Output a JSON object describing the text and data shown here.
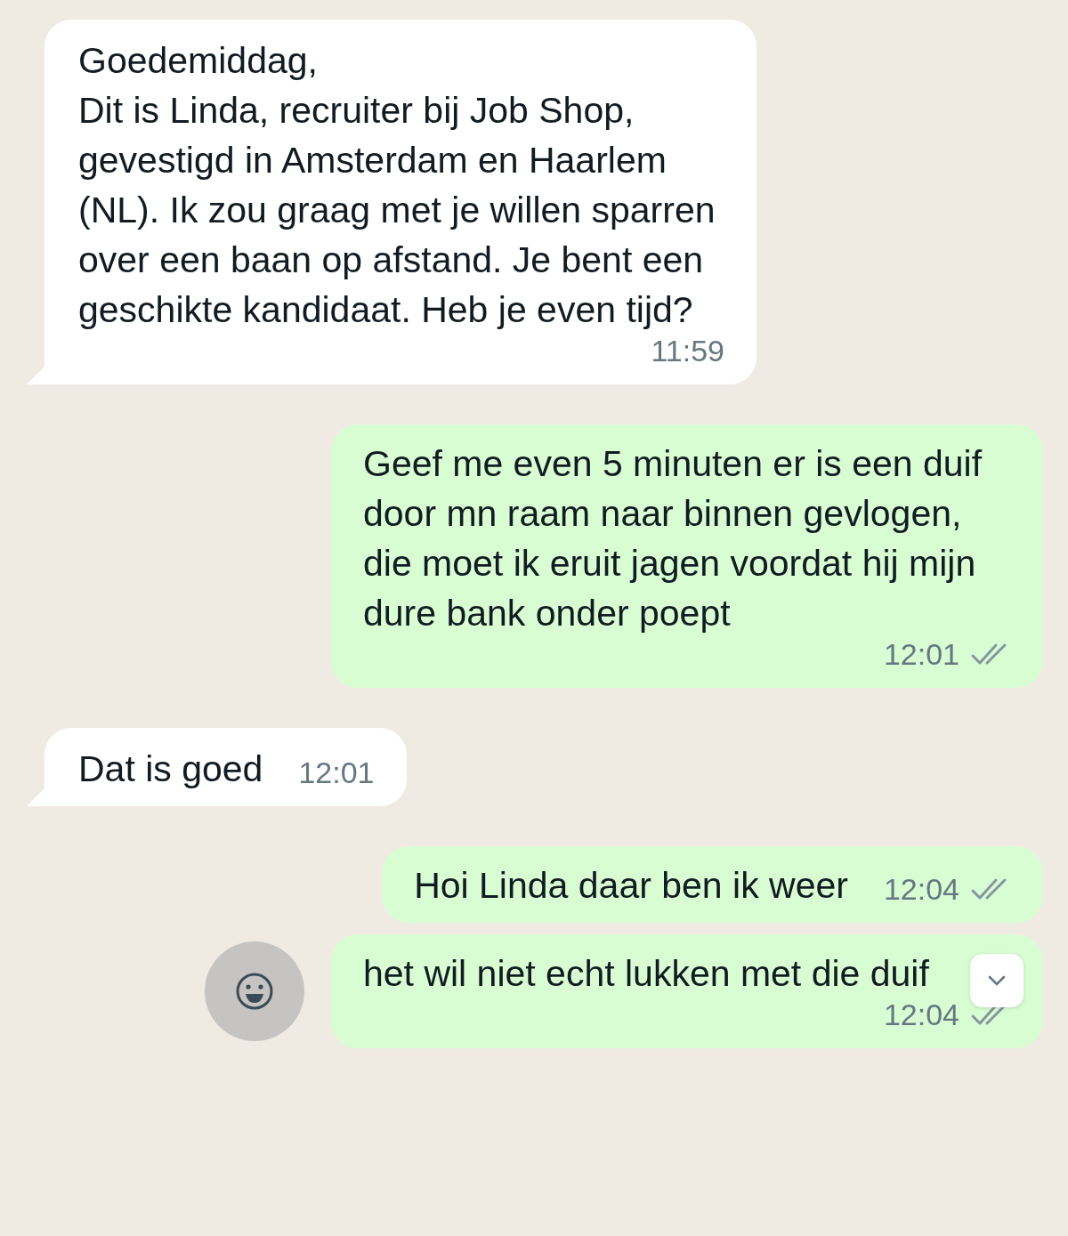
{
  "messages": [
    {
      "outgoing": false,
      "text": "Goedemiddag,\nDit is Linda, recruiter bij Job Shop, gevestigd in Amsterdam en Haarlem (NL). Ik zou graag met je willen sparren over een baan op afstand. Je bent een geschikte kandidaat. Heb je even tijd?",
      "time": "11:59"
    },
    {
      "outgoing": true,
      "text": "Geef me even 5 minuten er is een duif door mn raam naar binnen gevlogen, die moet ik eruit jagen voordat hij mijn dure bank onder poept",
      "time": "12:01",
      "read": false
    },
    {
      "outgoing": false,
      "text": "Dat is goed",
      "time": "12:01"
    },
    {
      "outgoing": true,
      "text": "Hoi Linda daar ben ik weer",
      "time": "12:04",
      "read": false
    },
    {
      "outgoing": true,
      "text": "het wil niet echt lukken met die duif",
      "time": "12:04",
      "read": false,
      "hovered": true
    }
  ]
}
